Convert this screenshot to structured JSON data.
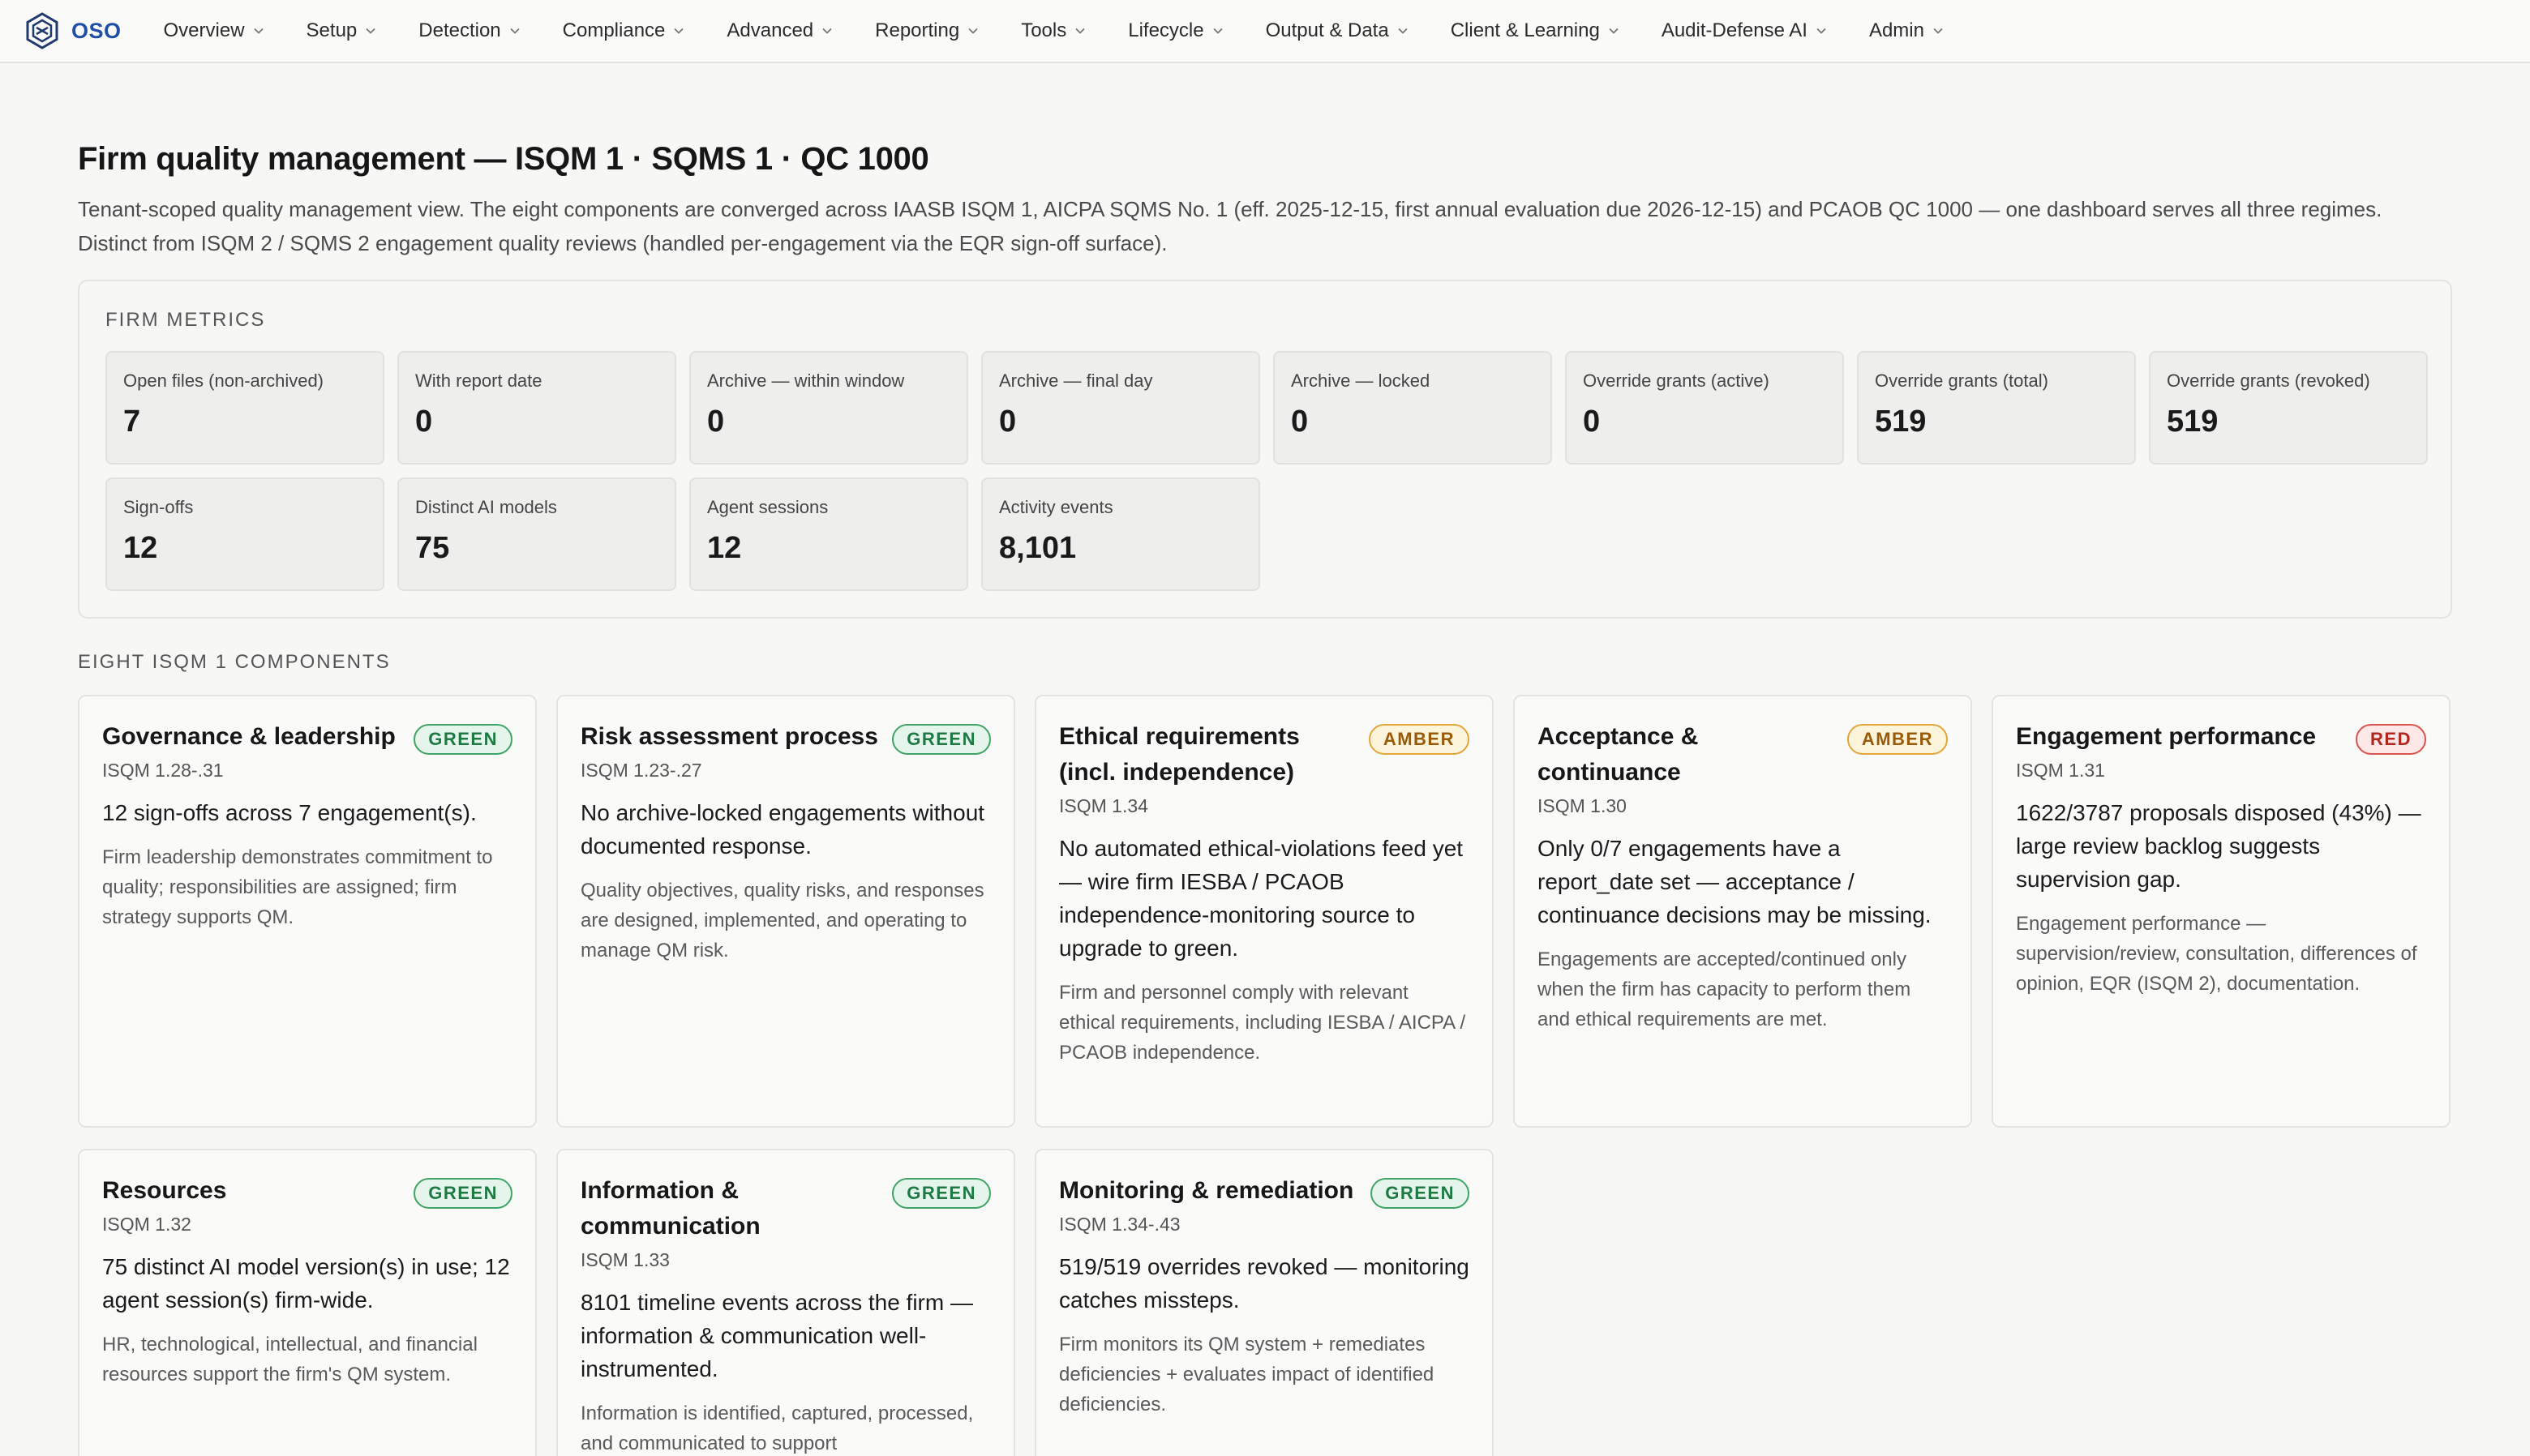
{
  "brand": {
    "name": "OSO",
    "logo_icon": "hexagon-logo-icon"
  },
  "nav": [
    {
      "label": "Overview"
    },
    {
      "label": "Setup"
    },
    {
      "label": "Detection"
    },
    {
      "label": "Compliance"
    },
    {
      "label": "Advanced"
    },
    {
      "label": "Reporting"
    },
    {
      "label": "Tools"
    },
    {
      "label": "Lifecycle"
    },
    {
      "label": "Output & Data"
    },
    {
      "label": "Client & Learning"
    },
    {
      "label": "Audit-Defense AI"
    },
    {
      "label": "Admin"
    }
  ],
  "page": {
    "title": "Firm quality management — ISQM 1 · SQMS 1 · QC 1000",
    "description": "Tenant-scoped quality management view. The eight components are converged across IAASB ISQM 1, AICPA SQMS No. 1 (eff. 2025-12-15, first annual evaluation due 2026-12-15) and PCAOB QC 1000 — one dashboard serves all three regimes. Distinct from ISQM 2 / SQMS 2 engagement quality reviews (handled per-engagement via the EQR sign-off surface)."
  },
  "metrics": {
    "section_label": "FIRM METRICS",
    "items": [
      {
        "label": "Open files (non-archived)",
        "value": "7"
      },
      {
        "label": "With report date",
        "value": "0"
      },
      {
        "label": "Archive — within window",
        "value": "0"
      },
      {
        "label": "Archive — final day",
        "value": "0"
      },
      {
        "label": "Archive — locked",
        "value": "0"
      },
      {
        "label": "Override grants (active)",
        "value": "0"
      },
      {
        "label": "Override grants (total)",
        "value": "519"
      },
      {
        "label": "Override grants (revoked)",
        "value": "519"
      },
      {
        "label": "Sign-offs",
        "value": "12"
      },
      {
        "label": "Distinct AI models",
        "value": "75"
      },
      {
        "label": "Agent sessions",
        "value": "12"
      },
      {
        "label": "Activity events",
        "value": "8,101"
      }
    ]
  },
  "components": {
    "section_label": "EIGHT ISQM 1 COMPONENTS",
    "colors": {
      "GREEN": "#1d7a43",
      "AMBER": "#9a5a07",
      "RED": "#b3261e"
    },
    "items": [
      {
        "title": "Governance & leadership",
        "badge": "GREEN",
        "ref": "ISQM 1.28-.31",
        "status": "12 sign-offs across 7 engagement(s).",
        "desc": "Firm leadership demonstrates commitment to quality; responsibilities are assigned; firm strategy supports QM."
      },
      {
        "title": "Risk assessment process",
        "badge": "GREEN",
        "ref": "ISQM 1.23-.27",
        "status": "No archive-locked engagements without documented response.",
        "desc": "Quality objectives, quality risks, and responses are designed, implemented, and operating to manage QM risk."
      },
      {
        "title": "Ethical requirements (incl. independence)",
        "badge": "AMBER",
        "ref": "ISQM 1.34",
        "status": "No automated ethical-violations feed yet — wire firm IESBA / PCAOB independence-monitoring source to upgrade to green.",
        "desc": "Firm and personnel comply with relevant ethical requirements, including IESBA / AICPA / PCAOB independence."
      },
      {
        "title": "Acceptance & continuance",
        "badge": "AMBER",
        "ref": "ISQM 1.30",
        "status": "Only 0/7 engagements have a report_date set — acceptance / continuance decisions may be missing.",
        "desc": "Engagements are accepted/continued only when the firm has capacity to perform them and ethical requirements are met."
      },
      {
        "title": "Engagement performance",
        "badge": "RED",
        "ref": "ISQM 1.31",
        "status": "1622/3787 proposals disposed (43%) — large review backlog suggests supervision gap.",
        "desc": "Engagement performance — supervision/review, consultation, differences of opinion, EQR (ISQM 2), documentation."
      },
      {
        "title": "Resources",
        "badge": "GREEN",
        "ref": "ISQM 1.32",
        "status": "75 distinct AI model version(s) in use; 12 agent session(s) firm-wide.",
        "desc": "HR, technological, intellectual, and financial resources support the firm's QM system."
      },
      {
        "title": "Information & communication",
        "badge": "GREEN",
        "ref": "ISQM 1.33",
        "status": "8101 timeline events across the firm — information & communication well-instrumented.",
        "desc": "Information is identified, captured, processed, and communicated to support"
      },
      {
        "title": "Monitoring & remediation",
        "badge": "GREEN",
        "ref": "ISQM 1.34-.43",
        "status": "519/519 overrides revoked — monitoring catches missteps.",
        "desc": "Firm monitors its QM system + remediates deficiencies + evaluates impact of identified deficiencies."
      }
    ]
  }
}
